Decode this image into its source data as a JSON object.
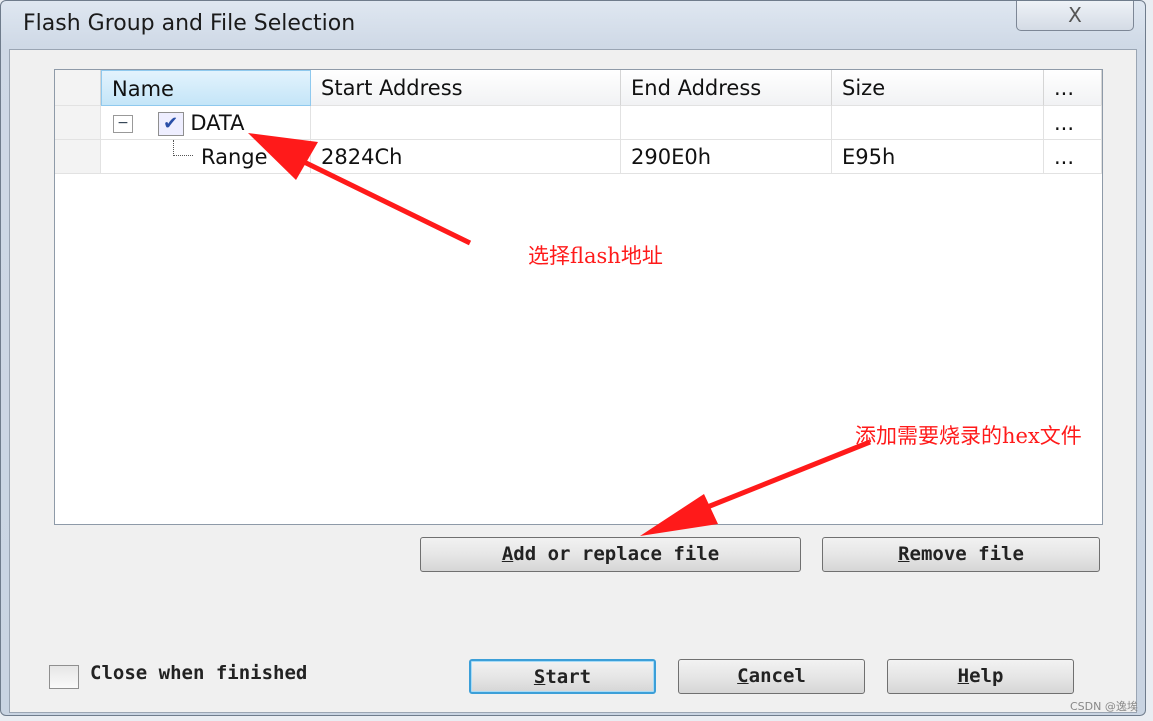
{
  "window": {
    "title": "Flash Group and File Selection",
    "close_glyph": "X"
  },
  "table": {
    "columns": [
      "Name",
      "Start Address",
      "End Address",
      "Size",
      "..."
    ],
    "rows": [
      {
        "expander": "−",
        "checked": true,
        "name": "DATA",
        "start": "",
        "end": "",
        "size": "",
        "more": "..."
      },
      {
        "name": "Range",
        "start": "2824Ch",
        "end": "290E0h",
        "size": "E95h",
        "more": "..."
      }
    ]
  },
  "buttons": {
    "add": {
      "accel": "A",
      "rest": "dd or replace file"
    },
    "remove": {
      "accel": "R",
      "rest": "emove file"
    },
    "start": {
      "accel": "S",
      "rest": "tart"
    },
    "cancel": {
      "accel": "C",
      "rest": "ancel"
    },
    "help": {
      "accel": "H",
      "rest": "elp"
    }
  },
  "close_when_finished": {
    "label": "Close when finished",
    "checked": false
  },
  "annotations": {
    "select_flash": "选择flash地址",
    "add_hex": "添加需要烧录的hex文件",
    "color": "#ff1a1a"
  },
  "watermark": "CSDN @逸埃"
}
